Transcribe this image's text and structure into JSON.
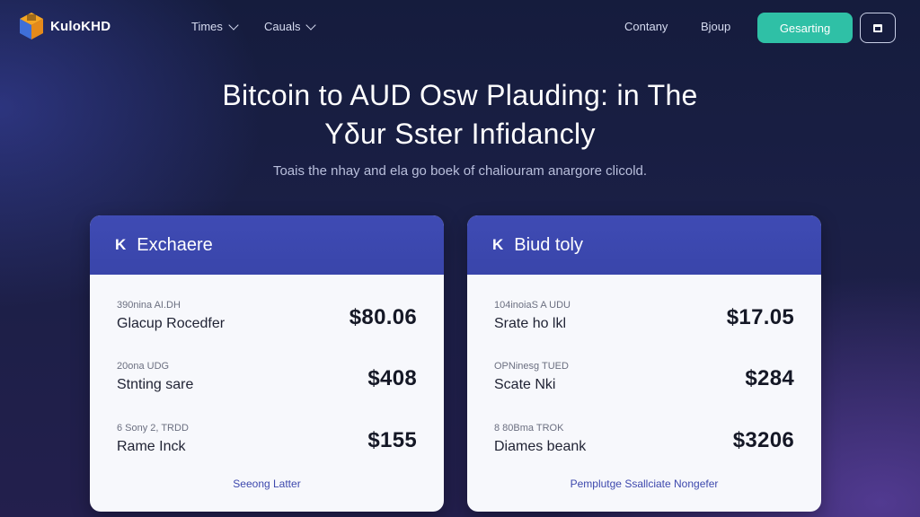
{
  "nav": {
    "brand": "KuloKHD",
    "links": [
      {
        "label": "Times"
      },
      {
        "label": "Cauals"
      }
    ],
    "right_links": [
      {
        "label": "Contany"
      },
      {
        "label": "Bjoup"
      }
    ],
    "cta_label": "Gesarting",
    "icon_button": "printer-icon",
    "colors": {
      "accent": "#2fc0a6",
      "card_header": "#3f4bb4"
    }
  },
  "hero": {
    "title_line1": "Bitcoin to AUD Osw Plauding: in The",
    "title_line2": "Yδur Sster Infidancly",
    "subtitle": "Toais the nhay and ela go boek of chaliouram anargore clicold."
  },
  "cards": [
    {
      "title": "Exchaere",
      "rows": [
        {
          "sub": "390nina AI.DH",
          "name": "Glacup Rocedfer",
          "value": "$80.06"
        },
        {
          "sub": "20ona UDG",
          "name": "Stnting sare",
          "value": "$408"
        },
        {
          "sub": "6 Sony 2, TRDD",
          "name": "Rame Inck",
          "value": "$155"
        }
      ],
      "footer": "Seeong Latter"
    },
    {
      "title": "Biud toly",
      "rows": [
        {
          "sub": "104inoiaS A UDU",
          "name": "Srate ho lkl",
          "value": "$17.05"
        },
        {
          "sub": "OPNinesg TUED",
          "name": "Scate Nki",
          "value": "$284"
        },
        {
          "sub": "8 80Bma TROK",
          "name": "Diames beank",
          "value": "$3206"
        }
      ],
      "footer": "Pemplutge Ssallciate Nongefer"
    }
  ]
}
